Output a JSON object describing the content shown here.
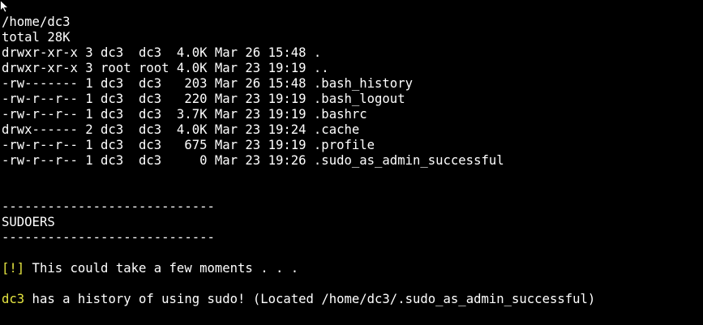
{
  "colors": {
    "background": "#000000",
    "text": "#ffffff",
    "highlight": "#e5e541"
  },
  "listing": {
    "cwd": "/home/dc3",
    "total": "total 28K",
    "entries": [
      "drwxr-xr-x 3 dc3  dc3  4.0K Mar 26 15:48 .",
      "drwxr-xr-x 3 root root 4.0K Mar 23 19:19 ..",
      "-rw------- 1 dc3  dc3   203 Mar 26 15:48 .bash_history",
      "-rw-r--r-- 1 dc3  dc3   220 Mar 23 19:19 .bash_logout",
      "-rw-r--r-- 1 dc3  dc3  3.7K Mar 23 19:19 .bashrc",
      "drwx------ 2 dc3  dc3  4.0K Mar 23 19:24 .cache",
      "-rw-r--r-- 1 dc3  dc3   675 Mar 23 19:19 .profile",
      "-rw-r--r-- 1 dc3  dc3     0 Mar 23 19:26 .sudo_as_admin_successful"
    ]
  },
  "section": {
    "divider": "----------------------------",
    "title": "SUDOERS"
  },
  "info": {
    "tag": "[!]",
    "text": " This could take a few moments . . ."
  },
  "finding": {
    "user": "dc3",
    "text": " has a history of using sudo! (Located /home/dc3/.sudo_as_admin_successful)"
  },
  "icons": {
    "cursor": "mouse-pointer-icon"
  }
}
